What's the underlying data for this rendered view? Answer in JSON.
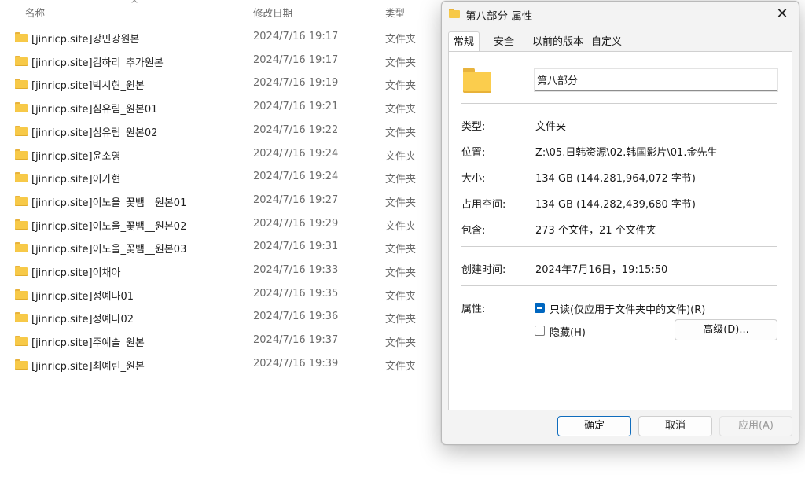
{
  "explorer": {
    "columns": {
      "name": "名称",
      "date": "修改日期",
      "type": "类型"
    },
    "sort_indicator": "^",
    "rows": [
      {
        "name": "[jinricp.site]강민강원본",
        "date": "2024/7/16 19:17",
        "type": "文件夹"
      },
      {
        "name": "[jinricp.site]김하리_추가원본",
        "date": "2024/7/16 19:17",
        "type": "文件夹"
      },
      {
        "name": "[jinricp.site]박시현_원본",
        "date": "2024/7/16 19:19",
        "type": "文件夹"
      },
      {
        "name": "[jinricp.site]심유림_원본01",
        "date": "2024/7/16 19:21",
        "type": "文件夹"
      },
      {
        "name": "[jinricp.site]심유림_원본02",
        "date": "2024/7/16 19:22",
        "type": "文件夹"
      },
      {
        "name": "[jinricp.site]윤소영",
        "date": "2024/7/16 19:24",
        "type": "文件夹"
      },
      {
        "name": "[jinricp.site]이가현",
        "date": "2024/7/16 19:24",
        "type": "文件夹"
      },
      {
        "name": "[jinricp.site]이노을_꽃뱀__원본01",
        "date": "2024/7/16 19:27",
        "type": "文件夹"
      },
      {
        "name": "[jinricp.site]이노을_꽃뱀__원본02",
        "date": "2024/7/16 19:29",
        "type": "文件夹"
      },
      {
        "name": "[jinricp.site]이노을_꽃뱀__원본03",
        "date": "2024/7/16 19:31",
        "type": "文件夹"
      },
      {
        "name": "[jinricp.site]이채아",
        "date": "2024/7/16 19:33",
        "type": "文件夹"
      },
      {
        "name": "[jinricp.site]정예나01",
        "date": "2024/7/16 19:35",
        "type": "文件夹"
      },
      {
        "name": "[jinricp.site]정예나02",
        "date": "2024/7/16 19:36",
        "type": "文件夹"
      },
      {
        "name": "[jinricp.site]주예솔_원본",
        "date": "2024/7/16 19:37",
        "type": "文件夹"
      },
      {
        "name": "[jinricp.site]최예린_원본",
        "date": "2024/7/16 19:39",
        "type": "文件夹"
      }
    ]
  },
  "dialog": {
    "title": "第八部分 属性",
    "close_symbol": "✕",
    "tabs": [
      {
        "label": "常规"
      },
      {
        "label": "安全"
      },
      {
        "label": "以前的版本"
      },
      {
        "label": "自定义"
      }
    ],
    "folder_name": "第八部分",
    "type_label": "类型:",
    "type_value": "文件夹",
    "location_label": "位置:",
    "location_value": "Z:\\05.日韩资源\\02.韩国影片\\01.金先生",
    "size_label": "大小:",
    "size_value": "134 GB (144,281,964,072 字节)",
    "disk_label": "占用空间:",
    "disk_value": "134 GB (144,282,439,680 字节)",
    "contains_label": "包含:",
    "contains_value": "273 个文件，21 个文件夹",
    "created_label": "创建时间:",
    "created_value": "2024年7月16日，19:15:50",
    "attributes_label": "属性:",
    "readonly_label": "只读(仅应用于文件夹中的文件)(R)",
    "hidden_label": "隐藏(H)",
    "advanced_label": "高级(D)...",
    "ok_label": "确定",
    "cancel_label": "取消",
    "apply_label": "应用(A)",
    "colors": {
      "accent": "#0067c0",
      "folder": "#f7c948"
    }
  }
}
